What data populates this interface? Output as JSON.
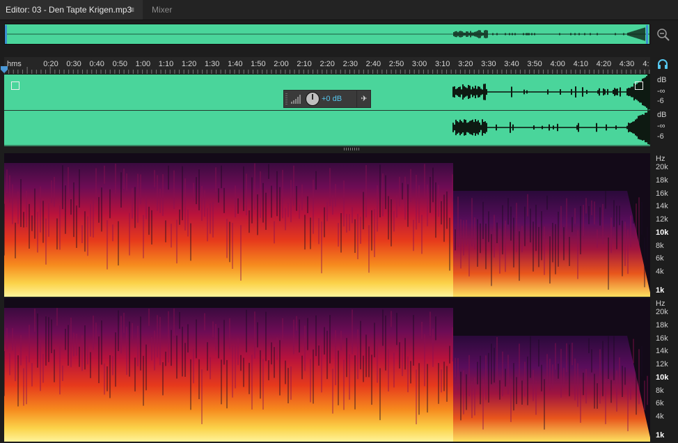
{
  "tabs": {
    "editor_label": "Editor: 03 - Den Tapte Krigen.mp3",
    "menu_glyph": "≡",
    "mixer_label": "Mixer"
  },
  "ruler": {
    "unit": "hms",
    "ticks": [
      "0:20",
      "0:30",
      "0:40",
      "0:50",
      "1:00",
      "1:10",
      "1:20",
      "1:30",
      "1:40",
      "1:50",
      "2:00",
      "2:10",
      "2:20",
      "2:30",
      "2:40",
      "2:50",
      "3:00",
      "3:10",
      "3:20",
      "3:30",
      "3:40",
      "3:50",
      "4:00",
      "4:10",
      "4:20",
      "4:30",
      "4:"
    ]
  },
  "hud": {
    "gain_value": "+0 dB",
    "pin_glyph": "✈"
  },
  "db_scale": {
    "channel_1": [
      "dB",
      "-∞",
      "-6"
    ],
    "channel_2": [
      "dB",
      "-∞",
      "-6"
    ]
  },
  "hz_scale": {
    "unit": "Hz",
    "labels": [
      "20k",
      "18k",
      "16k",
      "14k",
      "12k",
      "10k",
      "8k",
      "6k",
      "4k",
      "1k"
    ]
  },
  "colors": {
    "waveform_bg": "#4ad59b",
    "waveform_fg": "#0e1a12",
    "accent": "#56c8f0",
    "playhead": "#4b98d6"
  },
  "icons": {
    "zoom": "zoom-icon",
    "headphones": "headphones-icon",
    "fade_in": "fade-in-handle",
    "fade_out": "fade-out-handle"
  }
}
